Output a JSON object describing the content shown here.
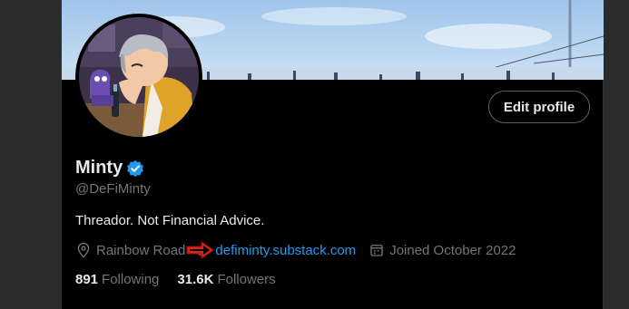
{
  "profile": {
    "name": "Minty",
    "handle": "@DeFiMinty",
    "bio": "Threador. Not Financial Advice.",
    "location": "Rainbow Road",
    "website": "defiminty.substack.com",
    "joined": "Joined October 2022",
    "following_count": "891",
    "following_label": "Following",
    "followers_count": "31.6K",
    "followers_label": "Followers"
  },
  "actions": {
    "edit_profile": "Edit profile"
  },
  "icons": {
    "verified": "verified-badge-icon",
    "location": "location-pin-icon",
    "calendar": "calendar-icon",
    "annotation": "red-arrow-icon"
  },
  "colors": {
    "background": "#000000",
    "primary_text": "#e7e9ea",
    "secondary_text": "#71767b",
    "link": "#1d9bf0",
    "verified": "#1d9bf0",
    "annotation": "#e0201b"
  }
}
